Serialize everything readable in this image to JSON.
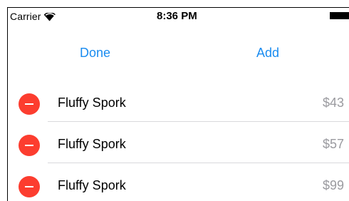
{
  "status_bar": {
    "carrier": "Carrier",
    "wifi_icon": "wifi-icon",
    "time": "8:36 PM",
    "battery_icon": "battery-icon"
  },
  "nav": {
    "done_label": "Done",
    "add_label": "Add",
    "accent_color": "#1a8cf0"
  },
  "items": [
    {
      "title": "Fluffy Spork",
      "price": "$43"
    },
    {
      "title": "Fluffy Spork",
      "price": "$57"
    },
    {
      "title": "Fluffy Spork",
      "price": "$99"
    }
  ],
  "colors": {
    "delete": "#fc3d2f",
    "price": "#9a9a9f",
    "separator": "#d9d9dc"
  }
}
